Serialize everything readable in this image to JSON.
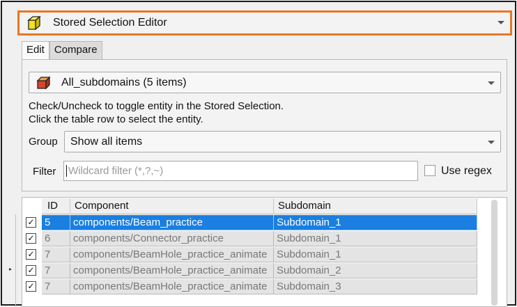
{
  "editor": {
    "title": "Stored Selection Editor",
    "icon": "yellow-cube-icon",
    "accent": "#e87722"
  },
  "tabs": [
    {
      "label": "Edit",
      "active": true
    },
    {
      "label": "Compare",
      "active": false
    }
  ],
  "selection": {
    "label": "All_subdomains (5 items)",
    "icon": "red-cube-icon"
  },
  "help": {
    "line1": "Check/Uncheck to toggle entity in the Stored Selection.",
    "line2": "Click the table row to select the entity."
  },
  "group": {
    "label": "Group",
    "value": "Show all items"
  },
  "filter": {
    "label": "Filter",
    "placeholder": "Wildcard filter (*,?,~)",
    "value": "",
    "regex_label": "Use regex",
    "regex_checked": false
  },
  "table": {
    "columns": [
      "ID",
      "Component",
      "Subdomain"
    ],
    "rows": [
      {
        "checked": true,
        "id": "5",
        "component": "components/Beam_practice",
        "subdomain": "Subdomain_1",
        "selected": true
      },
      {
        "checked": true,
        "id": "6",
        "component": "components/Connector_practice",
        "subdomain": "Subdomain_1",
        "selected": false
      },
      {
        "checked": true,
        "id": "7",
        "component": "components/BeamHole_practice_animate",
        "subdomain": "Subdomain_1",
        "selected": false
      },
      {
        "checked": true,
        "id": "7",
        "component": "components/BeamHole_practice_animate",
        "subdomain": "Subdomain_2",
        "selected": false
      },
      {
        "checked": true,
        "id": "7",
        "component": "components/BeamHole_practice_animate",
        "subdomain": "Subdomain_3",
        "selected": false
      }
    ],
    "check_glyph": "✓",
    "selected_color": "#1a7fe0"
  }
}
